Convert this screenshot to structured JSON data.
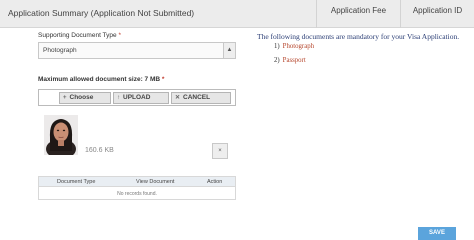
{
  "header": {
    "title": "Application Summary (Application Not Submitted)",
    "tabs": [
      "Application Fee",
      "Application ID"
    ]
  },
  "form": {
    "doc_type_label": "Supporting Document Type",
    "doc_type_value": "Photograph",
    "max_size_label": "Maximum allowed document size: 7 MB",
    "required_mark": "*",
    "choose_label": "Choose",
    "upload_label": "UPLOAD",
    "cancel_label": "CANCEL",
    "file_size": "160.6 KB",
    "remove_icon": "×"
  },
  "table": {
    "columns": [
      "Document Type",
      "View Document",
      "Action"
    ],
    "empty_text": "No records found."
  },
  "info": {
    "title": "The following documents are mandatory for your Visa Application.",
    "items": [
      {
        "num": "1)",
        "label": "Photograph"
      },
      {
        "num": "2)",
        "label": "Passport"
      }
    ]
  },
  "actions": {
    "save_label": "SAVE"
  },
  "colors": {
    "accent": "#5ba4dc",
    "doc_link": "#b5452b",
    "info_title": "#2b3e75",
    "required": "#c0392b"
  }
}
